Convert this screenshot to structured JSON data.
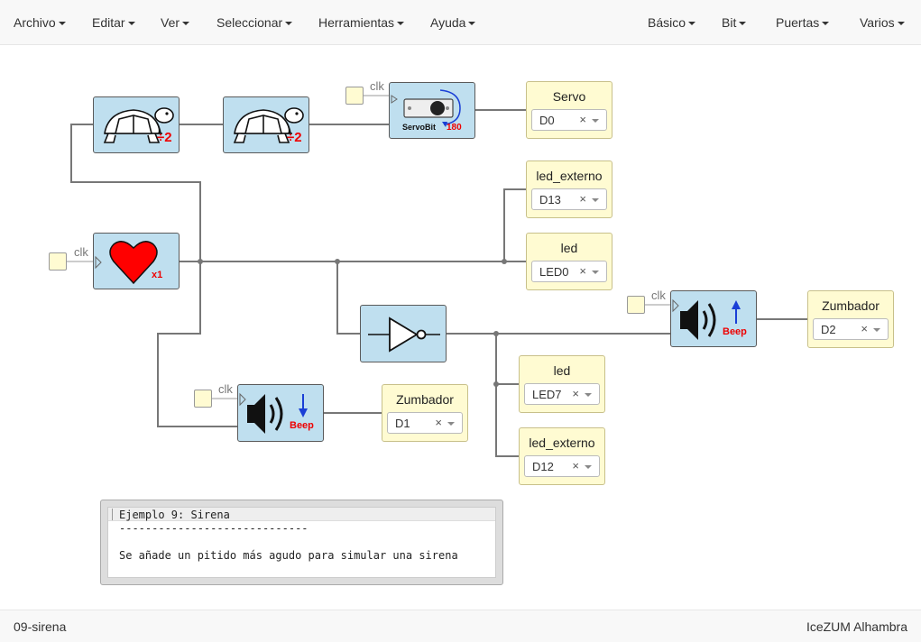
{
  "menubar": {
    "left": [
      "Archivo",
      "Editar",
      "Ver",
      "Seleccionar",
      "Herramientas",
      "Ayuda"
    ],
    "right": [
      "Básico",
      "Bit",
      "Puertas",
      "Varios"
    ]
  },
  "clk_label": "clk",
  "blocks": {
    "divider_badge": "÷2",
    "heart_badge": "x1",
    "servo_name": "ServoBit",
    "servo_angle": "180",
    "beep_label": "Beep"
  },
  "outputs": {
    "servo": {
      "title": "Servo",
      "value": "D0"
    },
    "led_externo_1": {
      "title": "led_externo",
      "value": "D13"
    },
    "led_1": {
      "title": "led",
      "value": "LED0"
    },
    "zumbador_1": {
      "title": "Zumbador",
      "value": "D2"
    },
    "zumbador_2": {
      "title": "Zumbador",
      "value": "D1"
    },
    "led_2": {
      "title": "led",
      "value": "LED7"
    },
    "led_externo_2": {
      "title": "led_externo",
      "value": "D12"
    }
  },
  "clear_symbol": "×",
  "note": {
    "line1": "Ejemplo 9: Sirena",
    "line2": "-----------------------------",
    "line3": "Se añade un pitido más agudo para simular una sirena"
  },
  "footer": {
    "file_name": "09-sirena",
    "app_name": "IceZUM Alhambra"
  },
  "colors": {
    "block_fill": "#bfdfef",
    "io_fill": "#fffbd2",
    "wire": "#777777",
    "beep_text": "#ff0000"
  }
}
